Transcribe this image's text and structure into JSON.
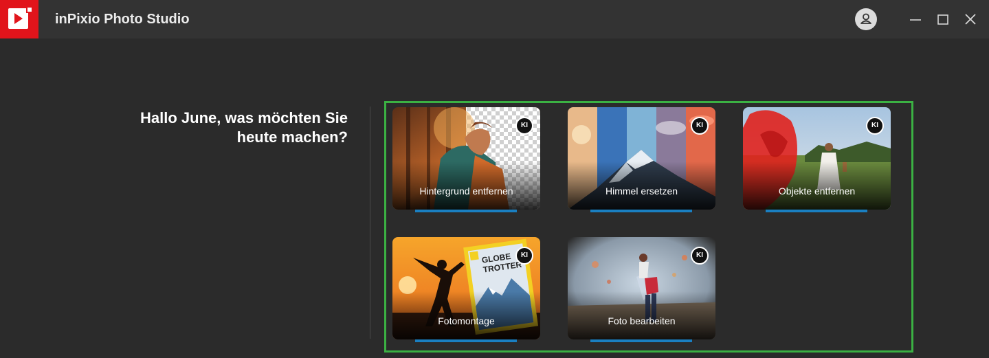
{
  "app": {
    "title": "inPixio Photo Studio"
  },
  "window_controls": {
    "account_icon": "user-icon",
    "minimize_icon": "minimize-icon",
    "maximize_icon": "maximize-icon",
    "close_icon": "close-icon"
  },
  "greeting": {
    "line1": "Hallo June, was möchten Sie",
    "line2": "heute machen?"
  },
  "cards": [
    {
      "label": "Hintergrund entfernen",
      "badge": "KI"
    },
    {
      "label": "Himmel ersetzen",
      "badge": "KI"
    },
    {
      "label": "Objekte entfernen",
      "badge": "KI"
    },
    {
      "label": "Fotomontage",
      "badge": "KI"
    },
    {
      "label": "Foto bearbeiten",
      "badge": "KI"
    }
  ],
  "colors": {
    "brand": "#e1141b",
    "accent": "#1a7fc1",
    "highlight": "#3bb143",
    "background": "#2b2b2b",
    "titlebar": "#333333"
  }
}
